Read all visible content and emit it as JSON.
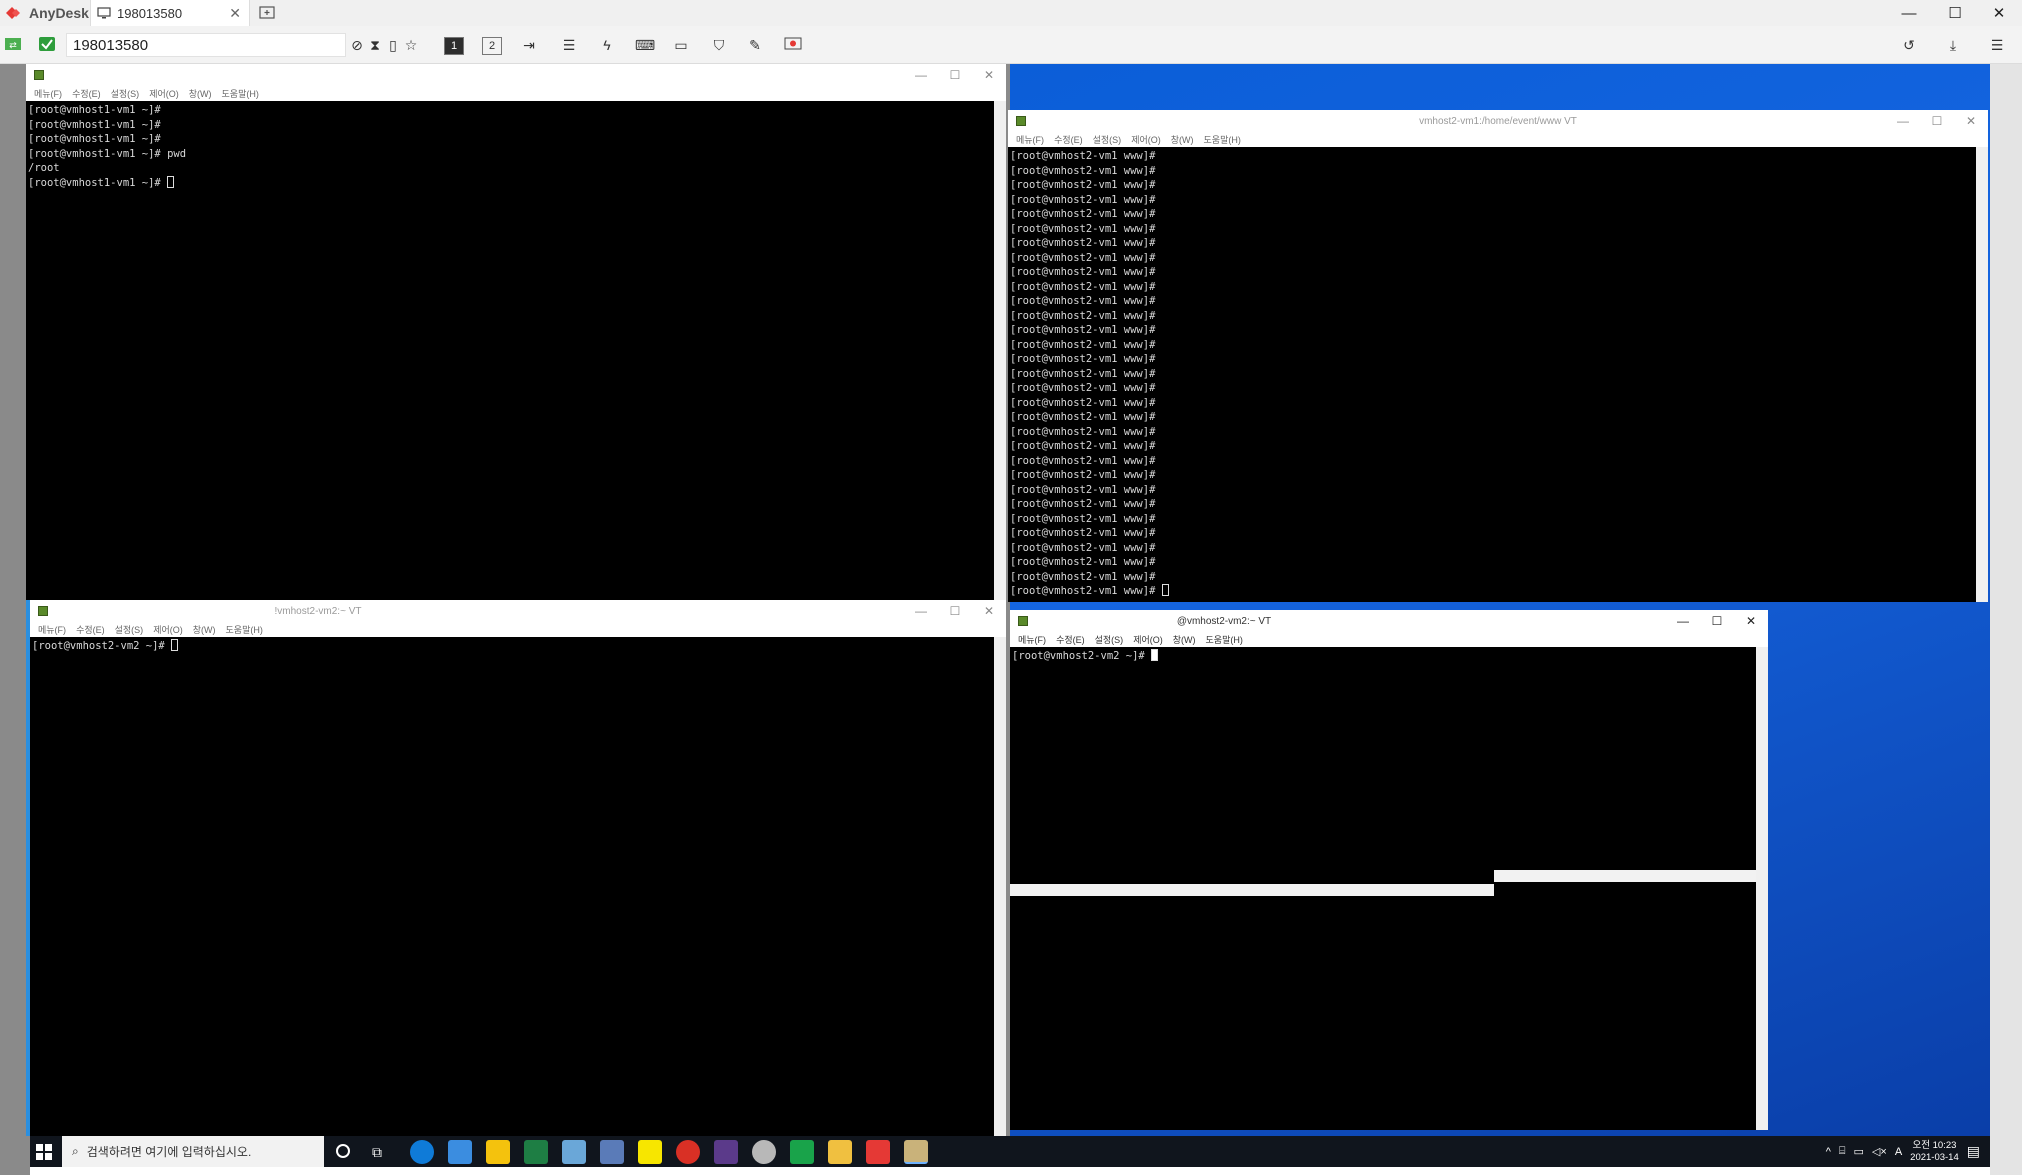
{
  "anydesk": {
    "brand": "AnyDesk",
    "tab_label": "198013580",
    "address": "198013580",
    "monitor_buttons": [
      "1",
      "2"
    ],
    "colors": {
      "brand": "#e53935",
      "toolbar": "#f3f3f3"
    }
  },
  "windows": {
    "top_left": {
      "title": "",
      "menu": [
        "메뉴(F)",
        "수정(E)",
        "설정(S)",
        "제어(O)",
        "창(W)",
        "도움말(H)"
      ],
      "lines": [
        "[root@vmhost1-vm1 ~]#",
        "[root@vmhost1-vm1 ~]#",
        "[root@vmhost1-vm1 ~]#",
        "[root@vmhost1-vm1 ~]# pwd",
        "/root",
        "[root@vmhost1-vm1 ~]# "
      ]
    },
    "top_right": {
      "title": "vmhost2-vm1:/home/event/www VT",
      "menu": [
        "메뉴(F)",
        "수정(E)",
        "설정(S)",
        "제어(O)",
        "창(W)",
        "도움말(H)"
      ],
      "prompt": "[root@vmhost2-vm1 www]#",
      "line_count": 31
    },
    "bottom_left": {
      "title": "!vmhost2-vm2:~ VT",
      "menu": [
        "메뉴(F)",
        "수정(E)",
        "설정(S)",
        "제어(O)",
        "창(W)",
        "도움말(H)"
      ],
      "lines": [
        "[root@vmhost2-vm2 ~]# "
      ]
    },
    "bottom_right": {
      "title": "@vmhost2-vm2:~ VT",
      "menu": [
        "메뉴(F)",
        "수정(E)",
        "설정(S)",
        "제어(O)",
        "창(W)",
        "도움말(H)"
      ],
      "lines": [
        "[root@vmhost2-vm2 ~]# "
      ]
    }
  },
  "taskbar": {
    "search_placeholder": "검색하려면 여기에 입력하십시오.",
    "clock_ampm": "오전 10:23",
    "clock_date": "2021-03-14",
    "ime": "A"
  }
}
